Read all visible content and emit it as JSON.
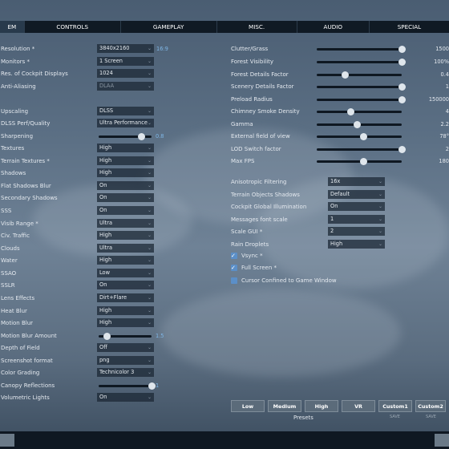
{
  "tabs": [
    {
      "label": "EM",
      "active": true
    },
    {
      "label": "CONTROLS",
      "active": false
    },
    {
      "label": "GAMEPLAY",
      "active": false
    },
    {
      "label": "MISC.",
      "active": false
    },
    {
      "label": "AUDIO",
      "active": false
    },
    {
      "label": "SPECIAL",
      "active": false
    }
  ],
  "left": {
    "resolution": {
      "label": "Resolution *",
      "value": "3840x2160",
      "note": "16:9"
    },
    "monitors": {
      "label": "Monitors *",
      "value": "1 Screen"
    },
    "cockpit_res": {
      "label": "Res. of Cockpit Displays",
      "value": "1024"
    },
    "antialias": {
      "label": "Anti-Aliasing",
      "value": "DLAA"
    },
    "upscaling": {
      "label": "Upscaling",
      "value": "DLSS"
    },
    "dlss_perf": {
      "label": "DLSS Perf/Quality",
      "value": "Ultra Performance"
    },
    "sharpening": {
      "label": "Sharpening",
      "value": "0.8",
      "fraction": 0.8
    },
    "textures": {
      "label": "Textures",
      "value": "High"
    },
    "terrain_textures": {
      "label": "Terrain Textures *",
      "value": "High"
    },
    "shadows": {
      "label": "Shadows",
      "value": "High"
    },
    "flat_shadows": {
      "label": "Flat Shadows Blur",
      "value": "On"
    },
    "secondary_shadows": {
      "label": "Secondary Shadows",
      "value": "On"
    },
    "sss": {
      "label": "SSS",
      "value": "On"
    },
    "visib_range": {
      "label": "Visib Range *",
      "value": "Ultra"
    },
    "civ_traffic": {
      "label": "Civ. Traffic",
      "value": "High"
    },
    "clouds": {
      "label": "Clouds",
      "value": "Ultra"
    },
    "water": {
      "label": "Water",
      "value": "High"
    },
    "ssao": {
      "label": "SSAO",
      "value": "Low"
    },
    "sslr": {
      "label": "SSLR",
      "value": "On"
    },
    "lens_effects": {
      "label": "Lens Effects",
      "value": "Dirt+Flare"
    },
    "heat_blur": {
      "label": "Heat Blur",
      "value": "High"
    },
    "motion_blur": {
      "label": "Motion Blur",
      "value": "High"
    },
    "motion_blur_amount": {
      "label": "Motion Blur Amount",
      "value": "1.5",
      "fraction": 0.15
    },
    "depth_of_field": {
      "label": "Depth of Field",
      "value": "Off"
    },
    "screenshot_format": {
      "label": "Screenshot format",
      "value": "png"
    },
    "color_grading": {
      "label": "Color Grading",
      "value": "Technicolor 3"
    },
    "canopy_reflections": {
      "label": "Canopy Reflections",
      "value": "1",
      "fraction": 1.0
    },
    "volumetric_lights": {
      "label": "Volumetric Lights",
      "value": "On"
    }
  },
  "right": {
    "clutter": {
      "label": "Clutter/Grass",
      "value": "1500",
      "fraction": 1.0
    },
    "forest_visibility": {
      "label": "Forest Visibility",
      "value": "100%",
      "fraction": 1.0
    },
    "forest_details": {
      "label": "Forest Details Factor",
      "value": "0.4",
      "fraction": 0.33
    },
    "scenery_details": {
      "label": "Scenery Details Factor",
      "value": "1",
      "fraction": 1.0
    },
    "preload_radius": {
      "label": "Preload Radius",
      "value": "150000",
      "fraction": 1.0
    },
    "chimney_smoke": {
      "label": "Chimney Smoke Density",
      "value": "4",
      "fraction": 0.4
    },
    "gamma": {
      "label": "Gamma",
      "value": "2.2",
      "fraction": 0.47
    },
    "fov": {
      "label": "External field of view",
      "value": "78°",
      "fraction": 0.55
    },
    "lod_switch": {
      "label": "LOD Switch factor",
      "value": "2",
      "fraction": 1.0
    },
    "max_fps": {
      "label": "Max FPS",
      "value": "180",
      "fraction": 0.55
    },
    "aniso": {
      "label": "Anisotropic Filtering",
      "value": "16x"
    },
    "terrain_shadows": {
      "label": "Terrain Objects Shadows",
      "value": "Default"
    },
    "cockpit_gi": {
      "label": "Cockpit Global Illumination",
      "value": "On"
    },
    "msg_font": {
      "label": "Messages font scale",
      "value": "1"
    },
    "scale_gui": {
      "label": "Scale GUI *",
      "value": "2"
    },
    "rain": {
      "label": "Rain Droplets",
      "value": "High"
    },
    "vsync": {
      "label": "Vsync *",
      "checked": true
    },
    "fullscreen": {
      "label": "Full Screen *",
      "checked": true
    },
    "cursor_confined": {
      "label": "Cursor Confined to Game Window",
      "checked": false
    }
  },
  "presets": {
    "title": "Presets",
    "buttons": [
      "Low",
      "Medium",
      "High",
      "VR",
      "Custom1",
      "Custom2"
    ],
    "save_label": "SAVE"
  },
  "colors": {
    "accent": "#5b8fc8",
    "tabbar": "#101a24",
    "preset_bg": "#5b6b7a"
  }
}
